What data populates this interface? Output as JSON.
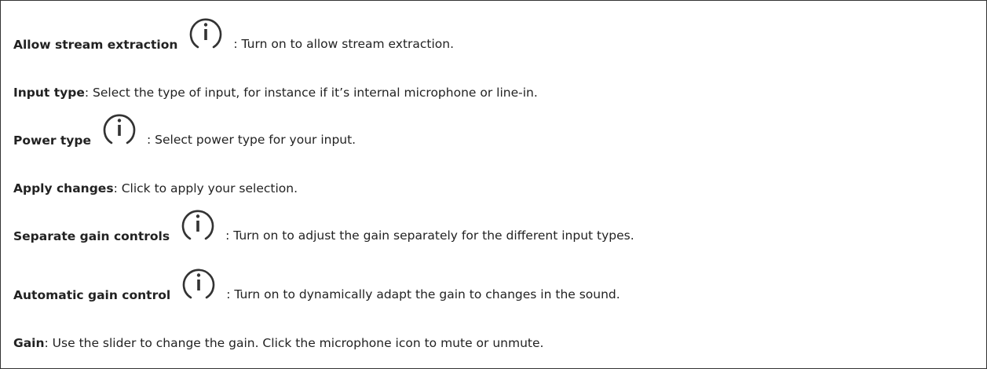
{
  "entries": {
    "stream_extraction": {
      "term": "Allow stream extraction",
      "icon": "info-icon",
      "desc": ": Turn on to allow stream extraction."
    },
    "input_type": {
      "term": "Input type",
      "desc": ": Select the type of input, for instance if it’s internal microphone or line-in."
    },
    "power_type": {
      "term": "Power type",
      "icon": "info-icon",
      "desc": ": Select power type for your input."
    },
    "apply_changes": {
      "term": "Apply changes",
      "desc": ": Click to apply your selection."
    },
    "separate_gain": {
      "term": "Separate gain controls",
      "icon": "info-icon",
      "desc": ": Turn on to adjust the gain separately for the different input types."
    },
    "automatic_gain": {
      "term": "Automatic gain control",
      "icon": "info-icon",
      "desc": ": Turn on to dynamically adapt the gain to changes in the sound."
    },
    "gain": {
      "term": "Gain",
      "desc": ": Use the slider to change the gain. Click the microphone icon to mute or unmute."
    }
  },
  "colors": {
    "text": "#222222",
    "border": "#333333",
    "icon_stroke": "#333333"
  }
}
